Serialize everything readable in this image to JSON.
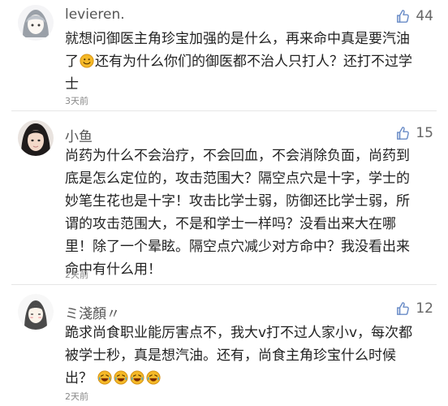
{
  "comments": [
    {
      "username": "levieren.",
      "likes": "44",
      "text_part1": "就想问御医主角珍宝加强的是什么，再来命中真是要汽油了",
      "emoji1": "smile-emoji",
      "text_part2": "还有为什么你们的御医都不治人只打人？还打不过学士",
      "time": "3天前"
    },
    {
      "username": "小鱼",
      "likes": "15",
      "text": "尚药为什么不会治疗，不会回血，不会消除负面，尚药到底是怎么定位的，攻击范围大？隔空点穴是十字，学士的妙笔生花也是十字！攻击比学士弱，防御还比学士弱，所谓的攻击范围大，不是和学士一样吗？没看出来大在哪里！除了一个晕眩。隔空点穴减少对方命中？我没看出来命中有什么用！",
      "time": "2天前"
    },
    {
      "username": "ミ淺顏〃",
      "likes": "12",
      "text": "跪求尚食职业能厉害点不，我大v打不过人家小v，每次都被学士秒，真是想汽油。还有，尚食主角珍宝什么时候出？",
      "emojis": [
        "laugh-cry-emoji",
        "laugh-cry-emoji",
        "laugh-cry-emoji",
        "laugh-cry-emoji"
      ],
      "time": "2天前"
    }
  ],
  "colors": {
    "text": "#222222",
    "username": "#555555",
    "meta": "#888888",
    "divider": "#e6e6e6",
    "emoji": "#f5b928"
  }
}
